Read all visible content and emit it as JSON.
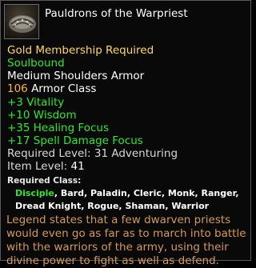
{
  "item": {
    "name": "Pauldrons of the Warpriest",
    "icon": "pauldron-armor-icon",
    "membership": "Gold Membership Required",
    "binding": "Soulbound",
    "armor_type": "Medium Shoulders Armor",
    "armor_value": "106",
    "armor_label": " Armor Class",
    "stats": [
      "+3 Vitality",
      "+10 Wisdom",
      "+35 Healing Focus",
      "+17 Spell Damage Focus"
    ],
    "required_level": "Required Level: 31 Adventuring",
    "item_level": "Item Level: ",
    "item_level_value": "41",
    "required_class_label": "Required Class:",
    "classes_highlight": "Disciple",
    "classes_rest": ", Bard, Paladin, Cleric, Monk, Ranger, Dread Knight, Rogue, Shaman, Warrior",
    "lore": "Legend states that a few dwarven priests would even go as far as to march into battle with the warriors of the army, using their divine power to fight as well as defend."
  },
  "colors": {
    "title": "#ffffff",
    "membership": "#ffd95a",
    "soulbound": "#2ee82e",
    "stats": "#2ee82e",
    "armor_value": "#ffb52a",
    "lore": "#d49a55"
  }
}
